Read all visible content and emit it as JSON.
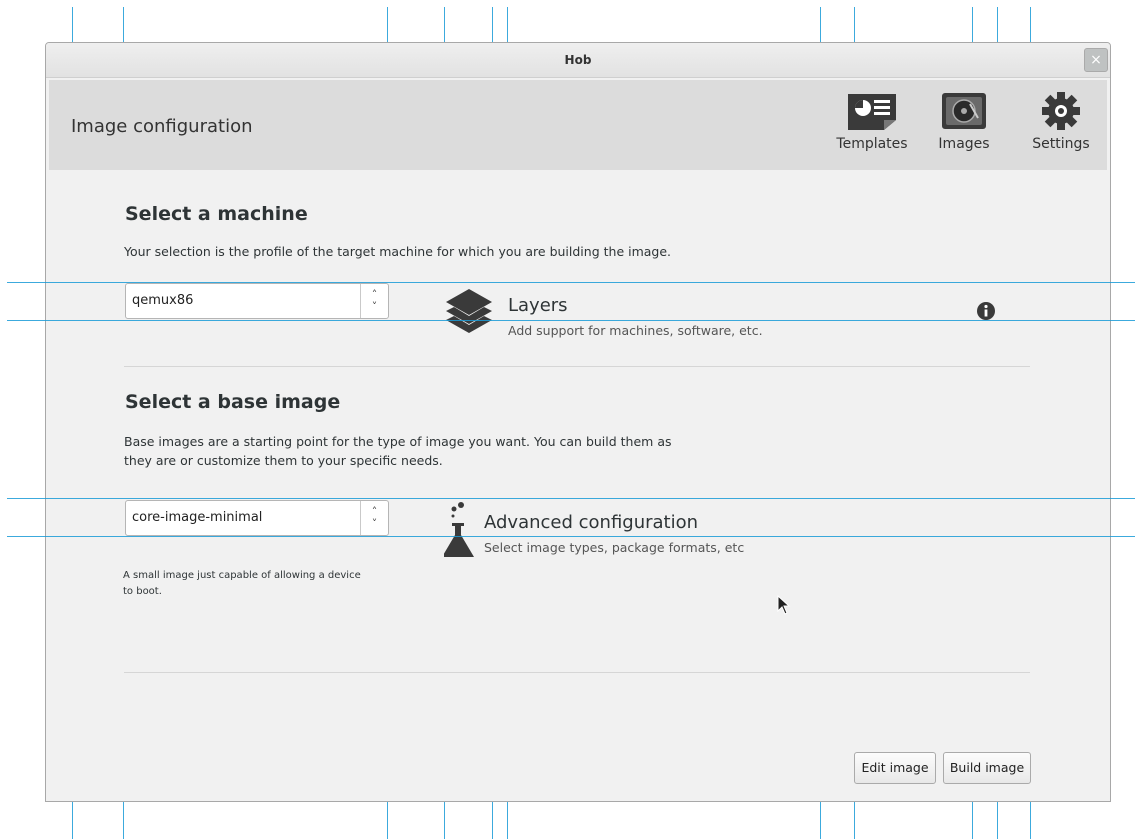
{
  "window": {
    "title": "Hob",
    "close_symbol": "×"
  },
  "header": {
    "title": "Image configuration",
    "tools": [
      {
        "label": "Templates",
        "icon": "templates-icon"
      },
      {
        "label": "Images",
        "icon": "images-icon"
      },
      {
        "label": "Settings",
        "icon": "gear-icon"
      }
    ]
  },
  "machine": {
    "heading": "Select a machine",
    "description": "Your selection is the profile of the target machine for which you are building the image.",
    "selected": "qemux86"
  },
  "base_image": {
    "heading": "Select a base image",
    "description_line1": "Base images are a starting point for the type of image you want. You can build them as",
    "description_line2": "they are or customize them to your specific needs.",
    "selected": "core-image-minimal",
    "image_description_line1": "A small image just capable of allowing a device",
    "image_description_line2": "to boot."
  },
  "layers": {
    "title": "Layers",
    "subtitle": "Add support for machines, software, etc.",
    "icon": "layers-icon",
    "info_icon": "info-icon"
  },
  "advanced": {
    "title": "Advanced configuration",
    "subtitle": "Select image types, package formats, etc",
    "icon": "flask-icon"
  },
  "buttons": {
    "edit": "Edit image",
    "build": "Build image"
  },
  "colors": {
    "guide": "#1a9bd7",
    "header_bg": "#dcdcdc",
    "window_bg": "#f1f1f1"
  }
}
